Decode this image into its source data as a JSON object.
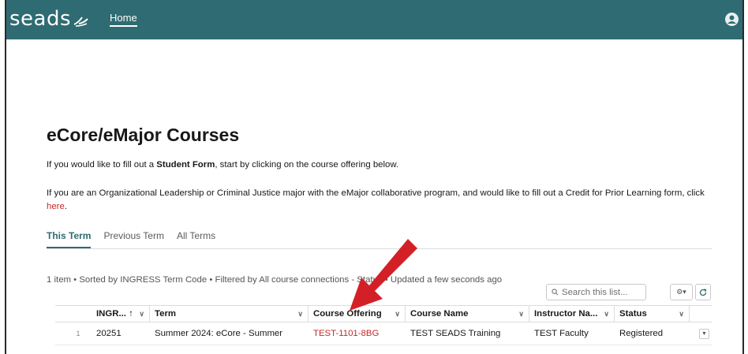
{
  "header": {
    "logo_text": "seads",
    "nav_home": "Home",
    "brand_color": "#2f6b72"
  },
  "main": {
    "title": "eCore/eMajor Courses",
    "intro_prefix": "If you would like to fill out a ",
    "intro_bold": "Student Form",
    "intro_suffix": ", start by clicking on the course offering below.",
    "cpl_text": "If you are an Organizational Leadership or Criminal Justice major with the eMajor collaborative program, and would like to fill out a Credit for Prior Learning form, click ",
    "cpl_link": "here",
    "cpl_end": "."
  },
  "tabs": [
    {
      "label": "This Term",
      "active": true
    },
    {
      "label": "Previous Term",
      "active": false
    },
    {
      "label": "All Terms",
      "active": false
    }
  ],
  "list": {
    "info": "1 item • Sorted by INGRESS Term Code • Filtered by All course connections - Status • Updated a few seconds ago",
    "search_placeholder": "Search this list..."
  },
  "table": {
    "columns": [
      "INGR... ↑",
      "Term",
      "Course Offering",
      "Course Name",
      "Instructor Na...",
      "Status"
    ],
    "rows": [
      {
        "num": "1",
        "ingress": "20251",
        "term": "Summer 2024: eCore - Summer",
        "course_offering": "TEST-1101-8BG",
        "course_name": "TEST SEADS Training",
        "instructor": "TEST Faculty",
        "status": "Registered"
      }
    ]
  },
  "colors": {
    "link": "#c62828",
    "annotation_arrow": "#d32027"
  }
}
